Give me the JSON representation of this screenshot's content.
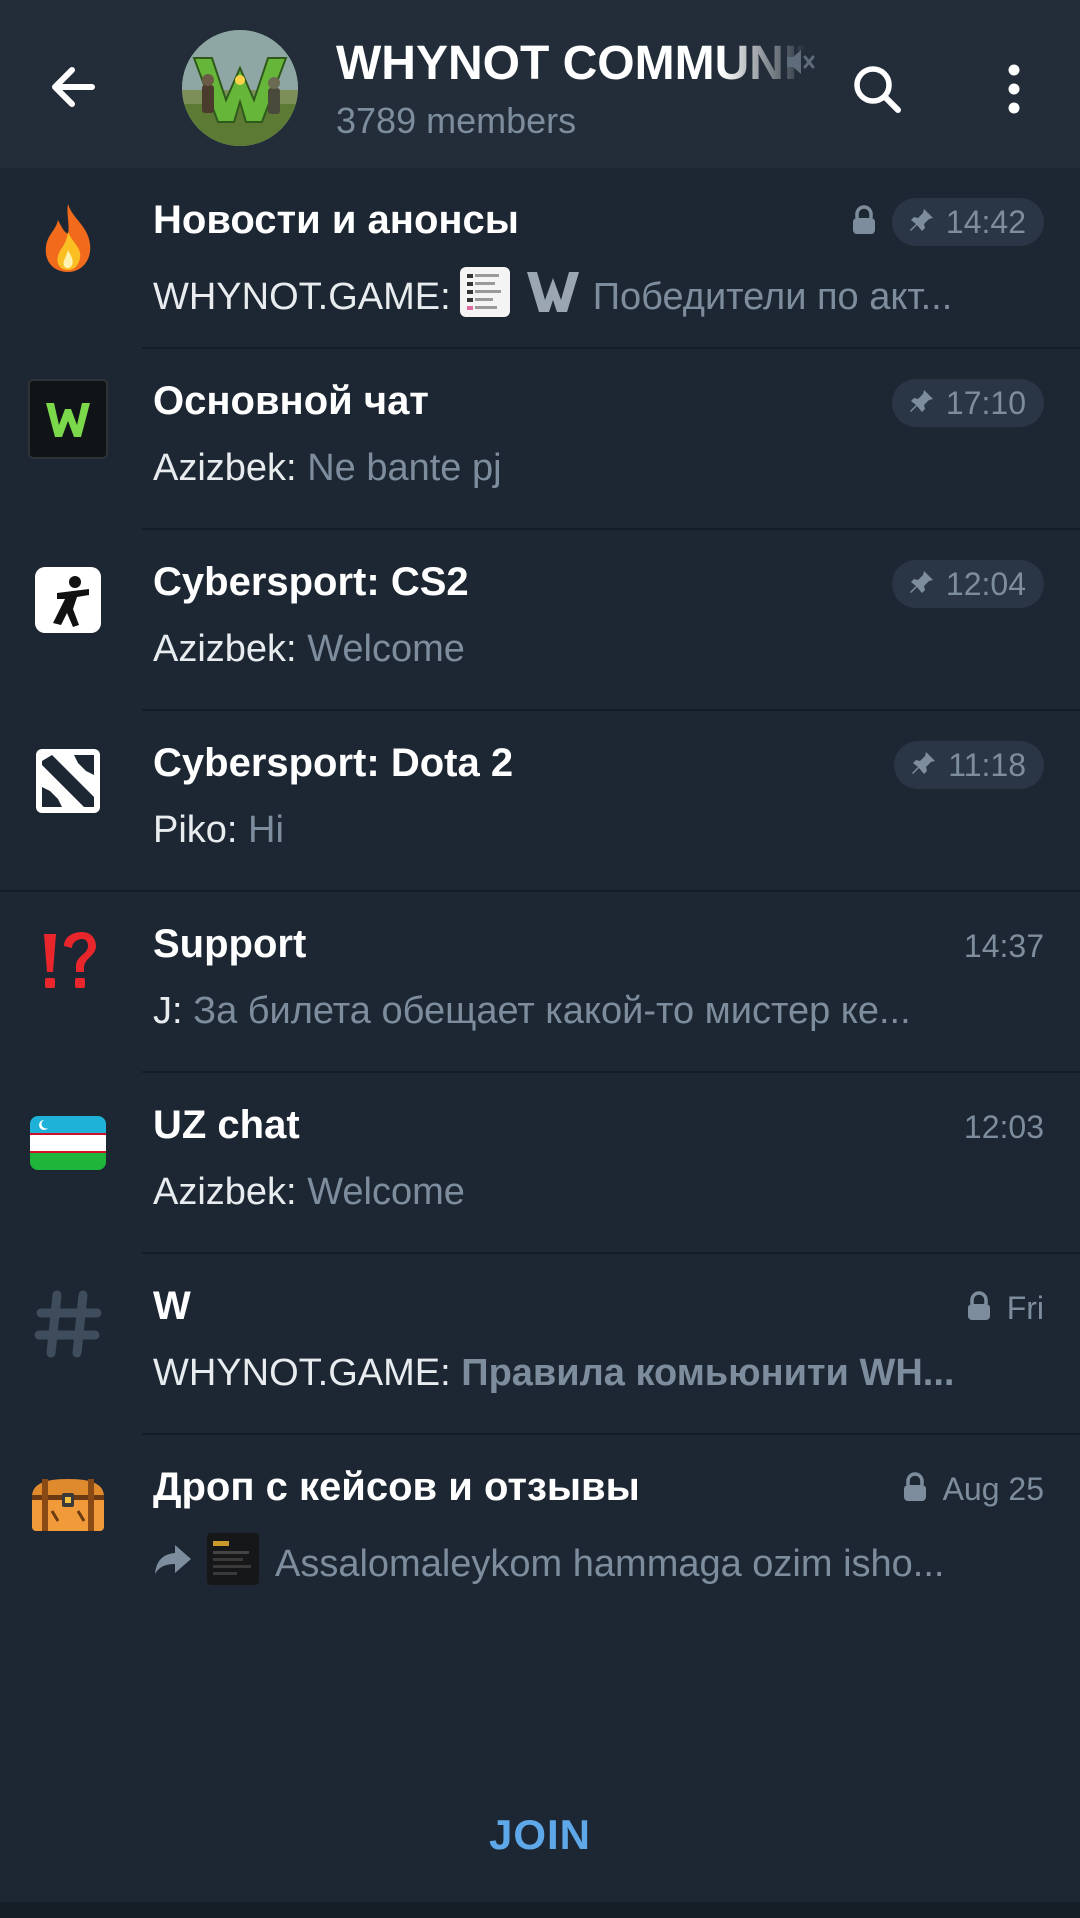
{
  "header": {
    "title": "WHYNOT COMMUNITY",
    "subtitle": "3789 members",
    "icons": [
      "back-arrow-icon",
      "group-avatar",
      "mute-icon",
      "search-icon",
      "more-vertical-icon"
    ]
  },
  "topics": [
    {
      "name": "Новости и анонсы",
      "icon": "fire-emoji",
      "locked": true,
      "pinned": true,
      "time": "14:42",
      "author": "WHYNOT.GAME:",
      "preview": "Победители по акт..."
    },
    {
      "name": "Основной чат",
      "icon": "whynot-logo",
      "locked": false,
      "pinned": true,
      "time": "17:10",
      "author": "Azizbek:",
      "preview": "Ne bante pj"
    },
    {
      "name": "Cybersport: CS2",
      "icon": "cs2-logo",
      "locked": false,
      "pinned": true,
      "time": "12:04",
      "author": "Azizbek:",
      "preview": "Welcome"
    },
    {
      "name": "Cybersport: Dota 2",
      "icon": "dota2-logo",
      "locked": false,
      "pinned": true,
      "time": "11:18",
      "author": "Piko:",
      "preview": "Hi"
    },
    {
      "name": "Support",
      "icon": "interrobang-emoji",
      "locked": false,
      "pinned": false,
      "time": "14:37",
      "author": "J:",
      "preview": "За билета обещает какой-то мистер ке..."
    },
    {
      "name": "UZ chat",
      "icon": "uzbekistan-flag",
      "locked": false,
      "pinned": false,
      "time": "12:03",
      "author": "Azizbek:",
      "preview": "Welcome"
    },
    {
      "name": "W",
      "icon": "hashtag-icon",
      "locked": true,
      "pinned": false,
      "time": "Fri",
      "author": "WHYNOT.GAME:",
      "preview": "Правила комьюнити WH..."
    },
    {
      "name": "Дроп с кейсов и отзывы",
      "icon": "treasure-chest-emoji",
      "locked": true,
      "pinned": false,
      "time": "Aug 25",
      "author": "",
      "preview": "Assalomaleykom hammaga ozim isho..."
    }
  ],
  "footer": {
    "join_label": "JOIN"
  },
  "colors": {
    "background": "#1d2733",
    "header": "#222d39",
    "muted_text": "#7e8d9d",
    "accent": "#5ea8e9"
  }
}
